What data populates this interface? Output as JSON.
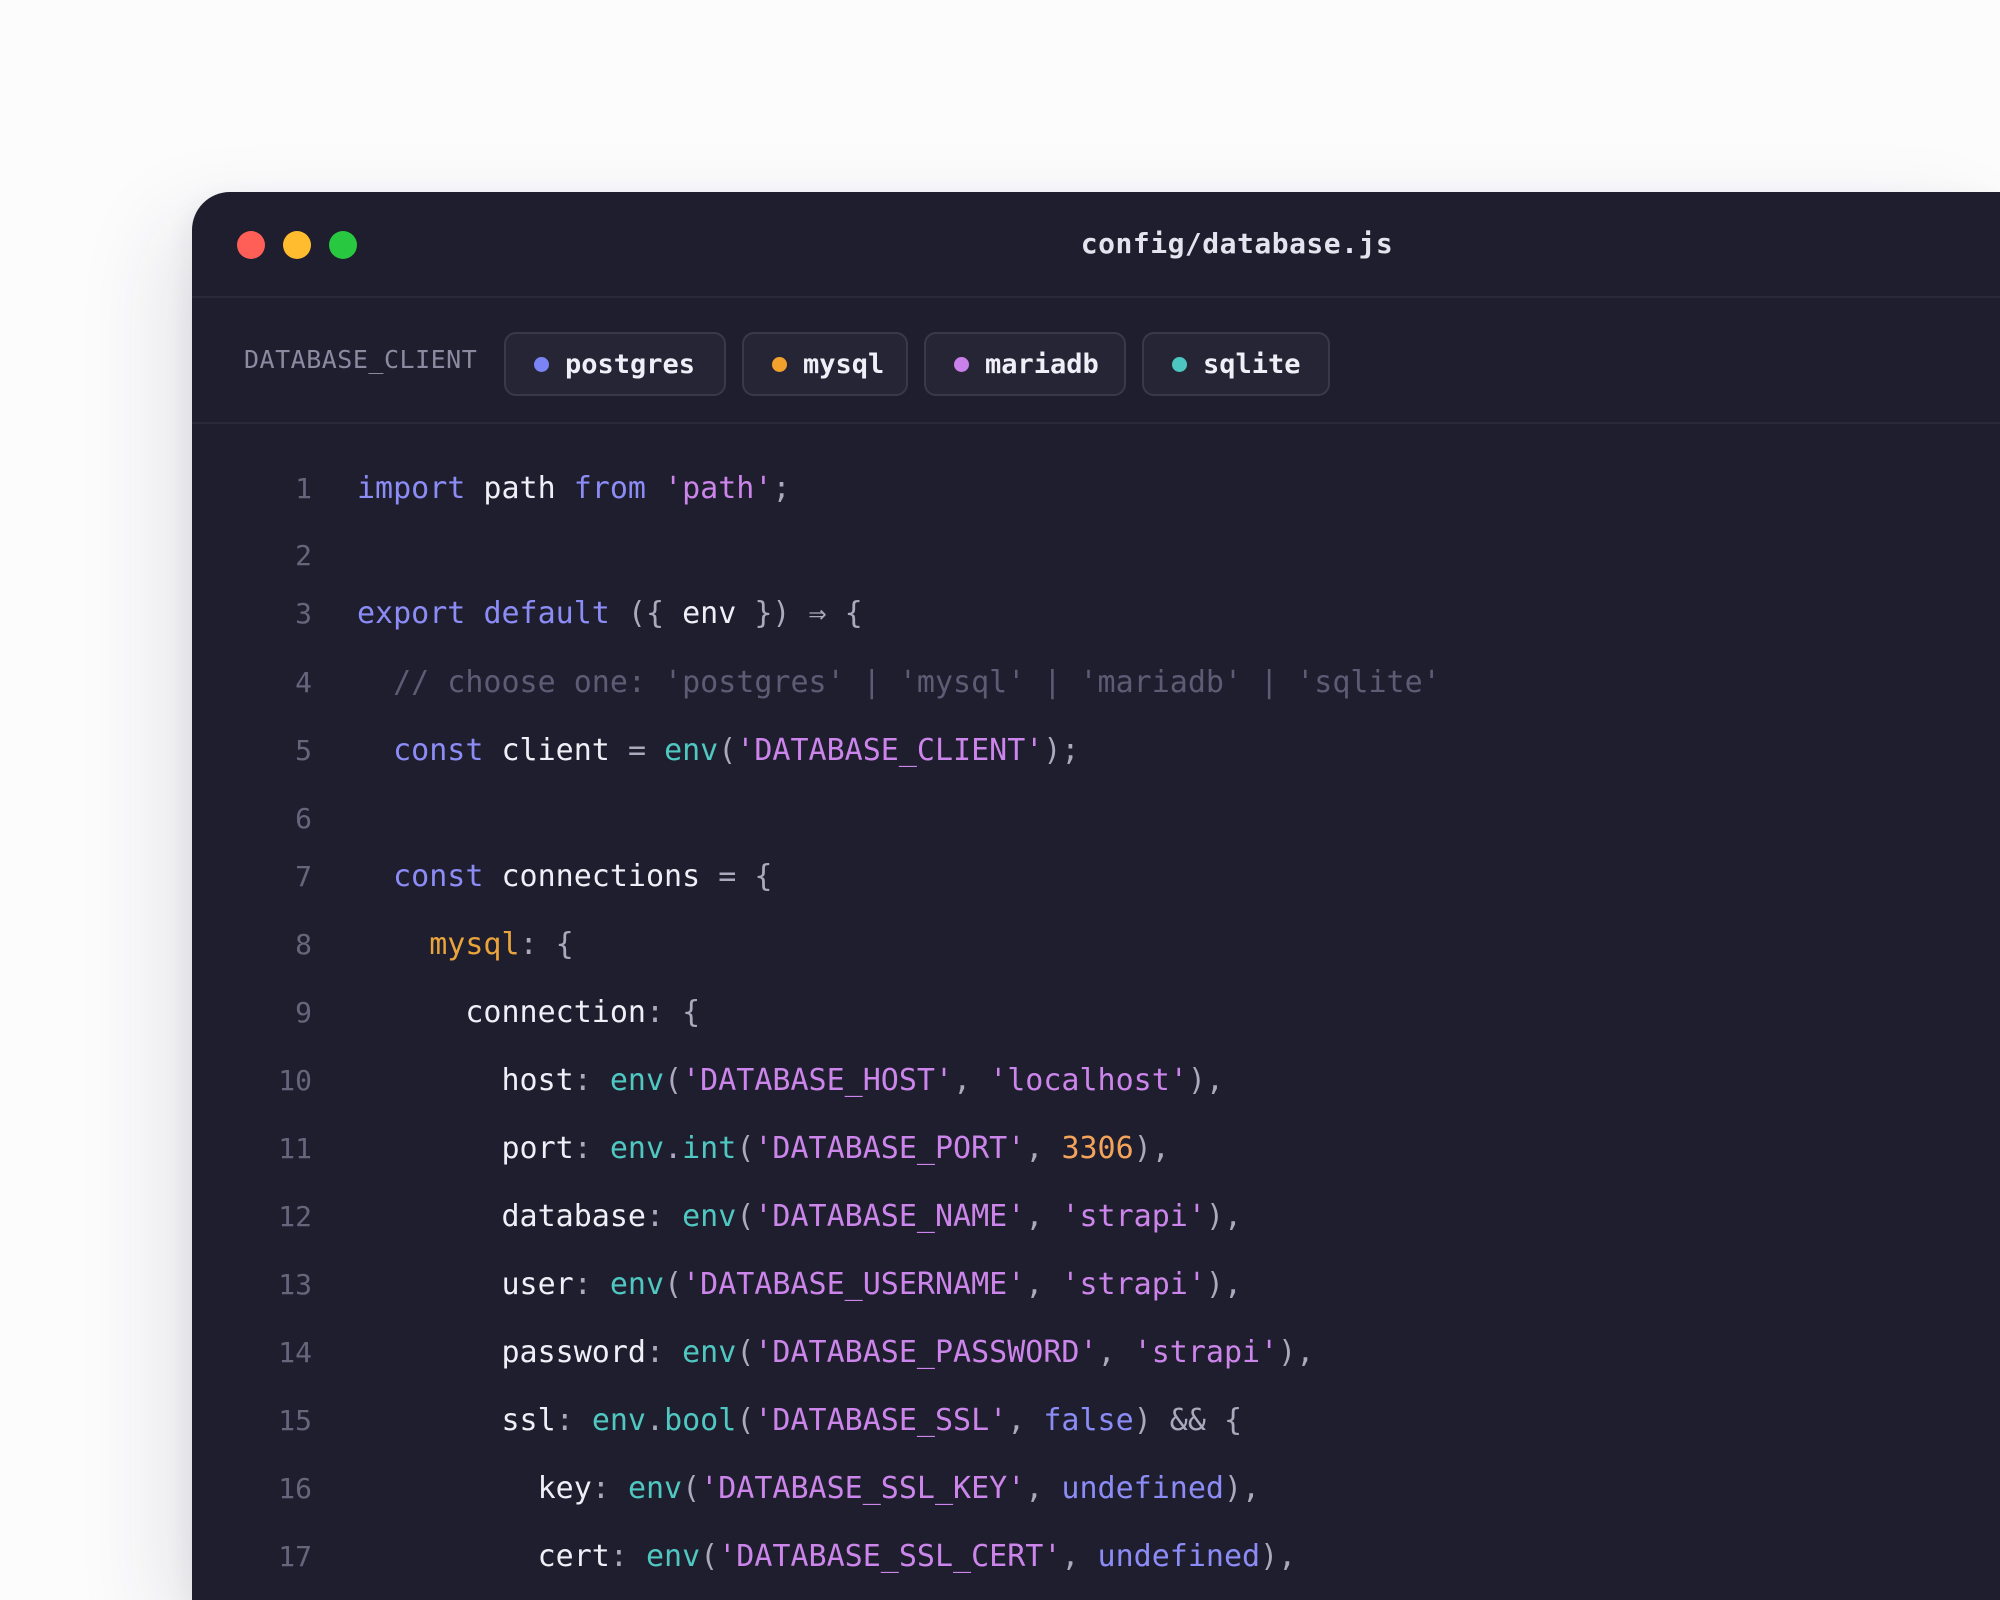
{
  "window": {
    "title": "config/database.js",
    "traffic_lights": [
      "close-dot",
      "minimize-dot",
      "zoom-dot"
    ]
  },
  "client_bar": {
    "label": "DATABASE_CLIENT",
    "options": [
      {
        "label": "postgres",
        "dot_color": "#7b84f4"
      },
      {
        "label": "mysql",
        "dot_color": "#f2a12c"
      },
      {
        "label": "mariadb",
        "dot_color": "#c980ea"
      },
      {
        "label": "sqlite",
        "dot_color": "#4cc6c0"
      }
    ]
  },
  "colors": {
    "background": "#1f1e2e",
    "keyword": "#8c8cf7",
    "string": "#cc85ea",
    "function": "#4fc8c2",
    "number": "#f4a35b",
    "comment": "#5d5c74"
  },
  "code": {
    "lines": [
      {
        "n": "1",
        "indent": "",
        "tokens": [
          {
            "t": "import",
            "c": "kw"
          },
          {
            "t": " path ",
            "c": "tx"
          },
          {
            "t": "from",
            "c": "kw"
          },
          {
            "t": " ",
            "c": "tx"
          },
          {
            "t": "'path'",
            "c": "str"
          },
          {
            "t": ";",
            "c": "pn"
          }
        ]
      },
      {
        "n": "2",
        "indent": "",
        "tokens": []
      },
      {
        "n": "3",
        "indent": "",
        "tokens": [
          {
            "t": "export",
            "c": "kw"
          },
          {
            "t": " ",
            "c": "tx"
          },
          {
            "t": "default",
            "c": "kw"
          },
          {
            "t": " ({ ",
            "c": "pn"
          },
          {
            "t": "env",
            "c": "tx"
          },
          {
            "t": " }) ⇒ {",
            "c": "pn"
          }
        ]
      },
      {
        "n": "4",
        "indent": "  ",
        "tokens": [
          {
            "t": "// choose one: 'postgres' | 'mysql' | 'mariadb' | 'sqlite'",
            "c": "cm"
          }
        ]
      },
      {
        "n": "5",
        "indent": "  ",
        "tokens": [
          {
            "t": "const",
            "c": "kw"
          },
          {
            "t": " client ",
            "c": "tx"
          },
          {
            "t": "= ",
            "c": "pn"
          },
          {
            "t": "env",
            "c": "fn"
          },
          {
            "t": "(",
            "c": "pn"
          },
          {
            "t": "'DATABASE_CLIENT'",
            "c": "str"
          },
          {
            "t": ");",
            "c": "pn"
          }
        ]
      },
      {
        "n": "6",
        "indent": "",
        "tokens": []
      },
      {
        "n": "7",
        "indent": "  ",
        "tokens": [
          {
            "t": "const",
            "c": "kw"
          },
          {
            "t": " connections ",
            "c": "tx"
          },
          {
            "t": "= {",
            "c": "pn"
          }
        ]
      },
      {
        "n": "8",
        "indent": "    ",
        "tokens": [
          {
            "t": "mysql",
            "c": "key-y"
          },
          {
            "t": ": {",
            "c": "pn"
          }
        ]
      },
      {
        "n": "9",
        "indent": "      ",
        "tokens": [
          {
            "t": "connection",
            "c": "tx"
          },
          {
            "t": ": {",
            "c": "pn"
          }
        ]
      },
      {
        "n": "10",
        "indent": "        ",
        "tokens": [
          {
            "t": "host",
            "c": "tx"
          },
          {
            "t": ": ",
            "c": "pn"
          },
          {
            "t": "env",
            "c": "fn"
          },
          {
            "t": "(",
            "c": "pn"
          },
          {
            "t": "'DATABASE_HOST'",
            "c": "str"
          },
          {
            "t": ", ",
            "c": "pn"
          },
          {
            "t": "'localhost'",
            "c": "str"
          },
          {
            "t": "),",
            "c": "pn"
          }
        ]
      },
      {
        "n": "11",
        "indent": "        ",
        "tokens": [
          {
            "t": "port",
            "c": "tx"
          },
          {
            "t": ": ",
            "c": "pn"
          },
          {
            "t": "env",
            "c": "fn"
          },
          {
            "t": ".",
            "c": "pn"
          },
          {
            "t": "int",
            "c": "fn"
          },
          {
            "t": "(",
            "c": "pn"
          },
          {
            "t": "'DATABASE_PORT'",
            "c": "str"
          },
          {
            "t": ", ",
            "c": "pn"
          },
          {
            "t": "3306",
            "c": "num"
          },
          {
            "t": "),",
            "c": "pn"
          }
        ]
      },
      {
        "n": "12",
        "indent": "        ",
        "tokens": [
          {
            "t": "database",
            "c": "tx"
          },
          {
            "t": ": ",
            "c": "pn"
          },
          {
            "t": "env",
            "c": "fn"
          },
          {
            "t": "(",
            "c": "pn"
          },
          {
            "t": "'DATABASE_NAME'",
            "c": "str"
          },
          {
            "t": ", ",
            "c": "pn"
          },
          {
            "t": "'strapi'",
            "c": "str"
          },
          {
            "t": "),",
            "c": "pn"
          }
        ]
      },
      {
        "n": "13",
        "indent": "        ",
        "tokens": [
          {
            "t": "user",
            "c": "tx"
          },
          {
            "t": ": ",
            "c": "pn"
          },
          {
            "t": "env",
            "c": "fn"
          },
          {
            "t": "(",
            "c": "pn"
          },
          {
            "t": "'DATABASE_USERNAME'",
            "c": "str"
          },
          {
            "t": ", ",
            "c": "pn"
          },
          {
            "t": "'strapi'",
            "c": "str"
          },
          {
            "t": "),",
            "c": "pn"
          }
        ]
      },
      {
        "n": "14",
        "indent": "        ",
        "tokens": [
          {
            "t": "password",
            "c": "tx"
          },
          {
            "t": ": ",
            "c": "pn"
          },
          {
            "t": "env",
            "c": "fn"
          },
          {
            "t": "(",
            "c": "pn"
          },
          {
            "t": "'DATABASE_PASSWORD'",
            "c": "str"
          },
          {
            "t": ", ",
            "c": "pn"
          },
          {
            "t": "'strapi'",
            "c": "str"
          },
          {
            "t": "),",
            "c": "pn"
          }
        ]
      },
      {
        "n": "15",
        "indent": "        ",
        "tokens": [
          {
            "t": "ssl",
            "c": "tx"
          },
          {
            "t": ": ",
            "c": "pn"
          },
          {
            "t": "env",
            "c": "fn"
          },
          {
            "t": ".",
            "c": "pn"
          },
          {
            "t": "bool",
            "c": "fn"
          },
          {
            "t": "(",
            "c": "pn"
          },
          {
            "t": "'DATABASE_SSL'",
            "c": "str"
          },
          {
            "t": ", ",
            "c": "pn"
          },
          {
            "t": "false",
            "c": "kw"
          },
          {
            "t": ") && {",
            "c": "pn"
          }
        ]
      },
      {
        "n": "16",
        "indent": "          ",
        "tokens": [
          {
            "t": "key",
            "c": "tx"
          },
          {
            "t": ": ",
            "c": "pn"
          },
          {
            "t": "env",
            "c": "fn"
          },
          {
            "t": "(",
            "c": "pn"
          },
          {
            "t": "'DATABASE_SSL_KEY'",
            "c": "str"
          },
          {
            "t": ", ",
            "c": "pn"
          },
          {
            "t": "undefined",
            "c": "kw"
          },
          {
            "t": "),",
            "c": "pn"
          }
        ]
      },
      {
        "n": "17",
        "indent": "          ",
        "tokens": [
          {
            "t": "cert",
            "c": "tx"
          },
          {
            "t": ": ",
            "c": "pn"
          },
          {
            "t": "env",
            "c": "fn"
          },
          {
            "t": "(",
            "c": "pn"
          },
          {
            "t": "'DATABASE_SSL_CERT'",
            "c": "str"
          },
          {
            "t": ", ",
            "c": "pn"
          },
          {
            "t": "undefined",
            "c": "kw"
          },
          {
            "t": "),",
            "c": "pn"
          }
        ]
      }
    ]
  }
}
